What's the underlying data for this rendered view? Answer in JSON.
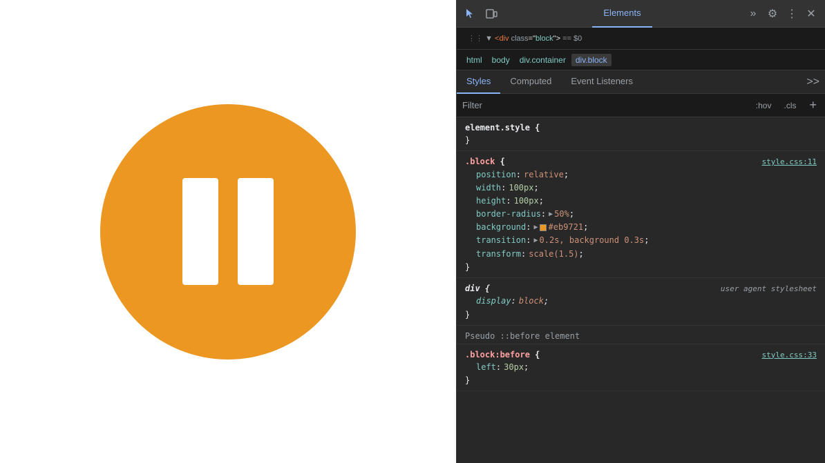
{
  "webpage": {
    "circle_color": "#eb9721",
    "pause_bar_color": "#ffffff"
  },
  "devtools": {
    "toolbar": {
      "cursor_icon": "⊹",
      "window_icon": "☐",
      "active_tab": "Elements",
      "tabs": [
        "Elements"
      ],
      "more_icon": "»",
      "settings_icon": "⚙",
      "menu_icon": "⋮",
      "close_icon": "✕"
    },
    "selected_node": {
      "tag": "div",
      "class": "block",
      "eq_sign": "==",
      "dollar": "$0"
    },
    "breadcrumb": {
      "items": [
        "html",
        "body",
        "div.container",
        "div.block"
      ]
    },
    "sub_tabs": {
      "items": [
        "Styles",
        "Computed",
        "Event Listeners"
      ],
      "active": "Styles",
      "more": ">>"
    },
    "filter": {
      "placeholder": "Filter",
      "hov_btn": ":hov",
      "cls_btn": ".cls",
      "add_icon": "+"
    },
    "css_rules": [
      {
        "id": "element-style",
        "selector": "element.style {",
        "closing": "}",
        "properties": [],
        "source": ""
      },
      {
        "id": "block-rule",
        "selector": ".block {",
        "closing": "}",
        "source": "style.css:11",
        "properties": [
          {
            "name": "position",
            "colon": ":",
            "value": "relative",
            "semicolon": ";",
            "type": "string"
          },
          {
            "name": "width",
            "colon": ":",
            "value": "100px",
            "semicolon": ";",
            "type": "number"
          },
          {
            "name": "height",
            "colon": ":",
            "value": "100px",
            "semicolon": ";",
            "type": "number"
          },
          {
            "name": "border-radius",
            "colon": ":",
            "value": "50%",
            "semicolon": ";",
            "type": "triangle",
            "triangle": "▶"
          },
          {
            "name": "background",
            "colon": ":",
            "value": "#eb9721",
            "semicolon": ";",
            "type": "color",
            "triangle": "▶",
            "swatch_color": "#eb9721"
          },
          {
            "name": "transition",
            "colon": ":",
            "value": "0.2s, background 0.3s",
            "semicolon": ";",
            "type": "triangle",
            "triangle": "▶"
          },
          {
            "name": "transform",
            "colon": ":",
            "value": "scale(1.5)",
            "semicolon": ";",
            "type": "string"
          }
        ]
      },
      {
        "id": "div-rule",
        "selector": "div {",
        "closing": "}",
        "source": "user agent stylesheet",
        "source_italic": true,
        "selector_italic": true,
        "properties": [
          {
            "name": "display",
            "colon": ":",
            "value": "block",
            "semicolon": ";",
            "type": "italic"
          }
        ]
      },
      {
        "id": "pseudo-before-header",
        "text": "Pseudo ::before element"
      },
      {
        "id": "block-before-rule",
        "selector": ".block:before {",
        "closing": "}",
        "source": "style.css:33",
        "properties": [
          {
            "name": "left",
            "colon": ":",
            "value": "30px",
            "semicolon": ";",
            "type": "number"
          }
        ]
      }
    ]
  }
}
